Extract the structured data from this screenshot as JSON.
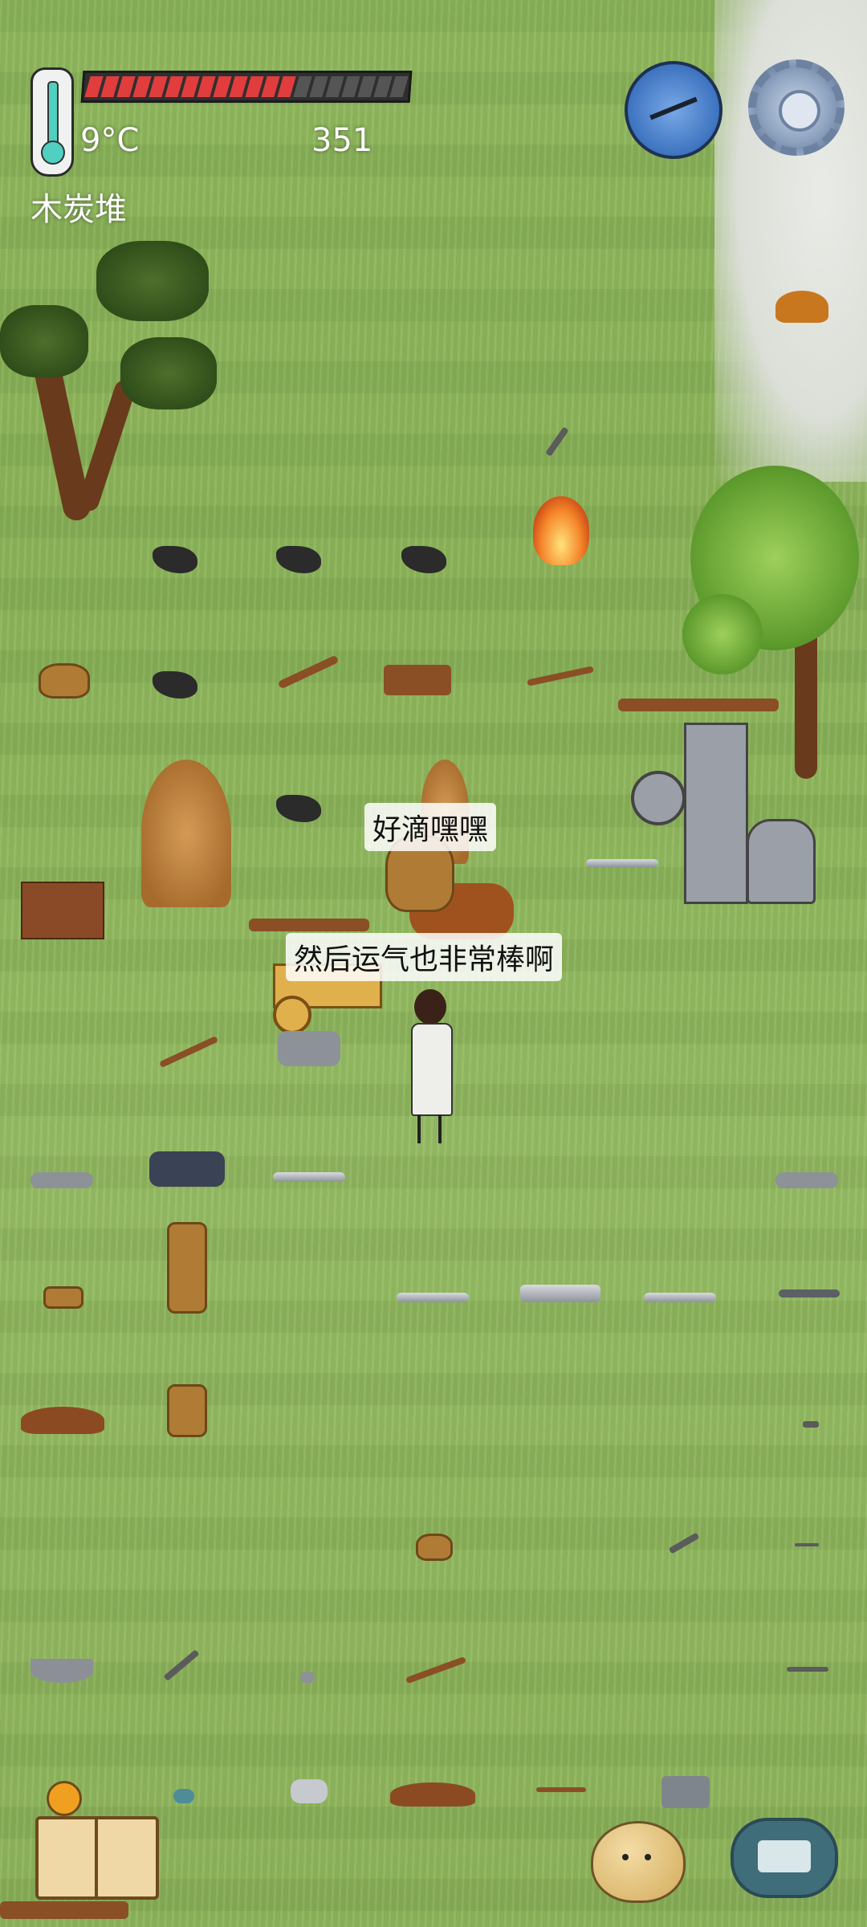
{
  "hud": {
    "temperature": "9°C",
    "yum_count": "351",
    "object_label": "木炭堆",
    "food_pips_total": 20,
    "food_pips_filled": 13,
    "icons": [
      "thermometer-icon",
      "compass-icon",
      "settings-gear-icon",
      "recipe-book-icon",
      "emote-face-icon",
      "keyboard-icon"
    ]
  },
  "speech": {
    "line1": "好滴嘿嘿",
    "line2": "然后运气也非常棒啊"
  },
  "colors": {
    "grass": "#8db65c",
    "food_bar_on": "#e13d3d",
    "food_bar_off": "#555555",
    "thermo_fluid": "#4fd0c0",
    "compass": "#3d73bf"
  }
}
